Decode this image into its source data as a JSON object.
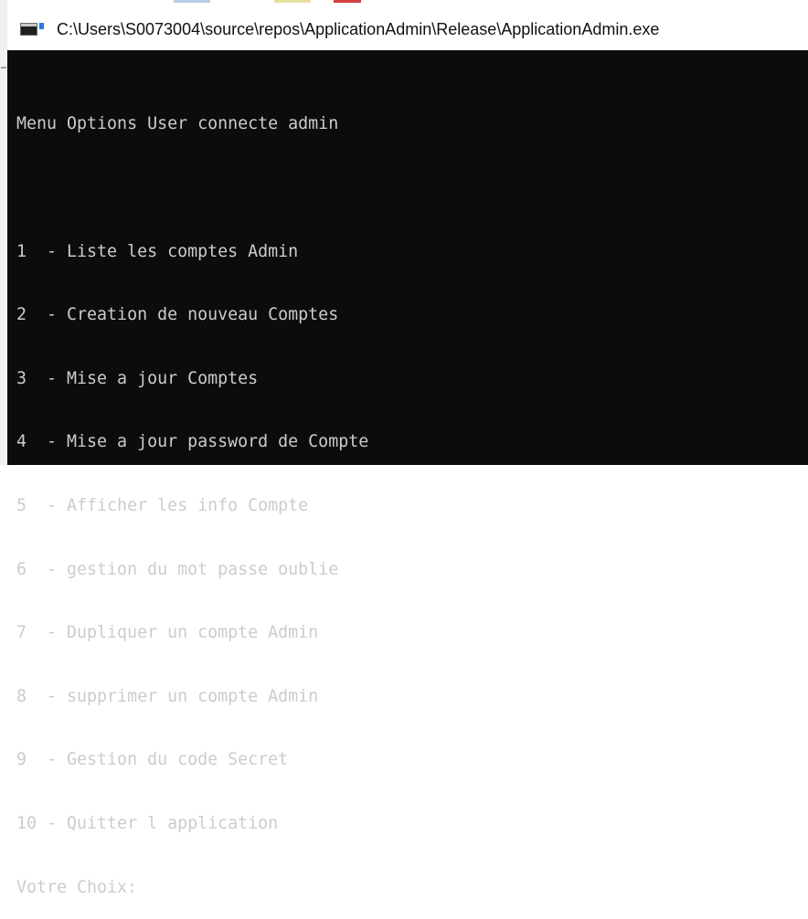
{
  "window": {
    "title": "C:\\Users\\S0073004\\source\\repos\\ApplicationAdmin\\Release\\ApplicationAdmin.exe"
  },
  "console": {
    "header": "Menu Options User connecte admin",
    "items": [
      "1  - Liste les comptes Admin",
      "2  - Creation de nouveau Comptes",
      "3  - Mise a jour Comptes",
      "4  - Mise a jour password de Compte",
      "5  - Afficher les info Compte",
      "6  - gestion du mot passe oublie",
      "7  - Dupliquer un compte Admin",
      "8  - supprimer un compte Admin",
      "9  - Gestion du code Secret",
      "10 - Quitter l application"
    ],
    "prompt": "Votre Choix:"
  },
  "colors": {
    "console_background": "#0c0c0c",
    "console_text": "#cccccc",
    "titlebar_background": "#ffffff"
  }
}
